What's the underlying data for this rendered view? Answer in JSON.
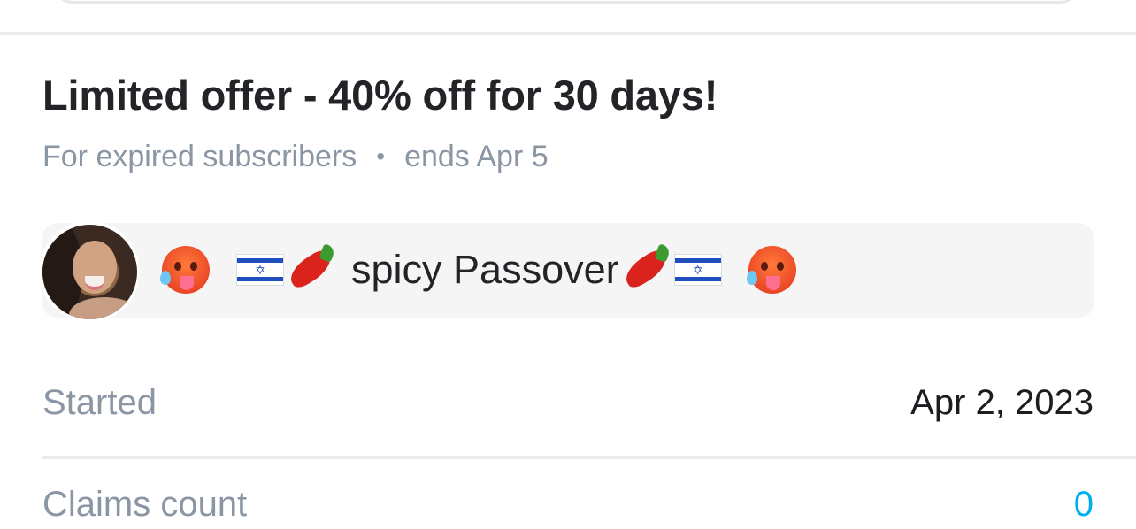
{
  "offer": {
    "title": "Limited offer - 40% off for 30 days!",
    "audience": "For expired subscribers",
    "separator": "•",
    "ends": "ends Apr 5"
  },
  "message": {
    "avatar_icon": "user-avatar-photo",
    "text": "spicy Passover",
    "emojis": [
      "hot-face-emoji",
      "israel-flag-emoji",
      "hot-pepper-emoji"
    ]
  },
  "details": {
    "started_label": "Started",
    "started_value": "Apr 2, 2023",
    "next_label": "Claims count",
    "next_value": "0"
  },
  "colors": {
    "accent": "#00aff0",
    "muted_text": "#8a96a3",
    "card_bg": "#f5f5f6"
  }
}
